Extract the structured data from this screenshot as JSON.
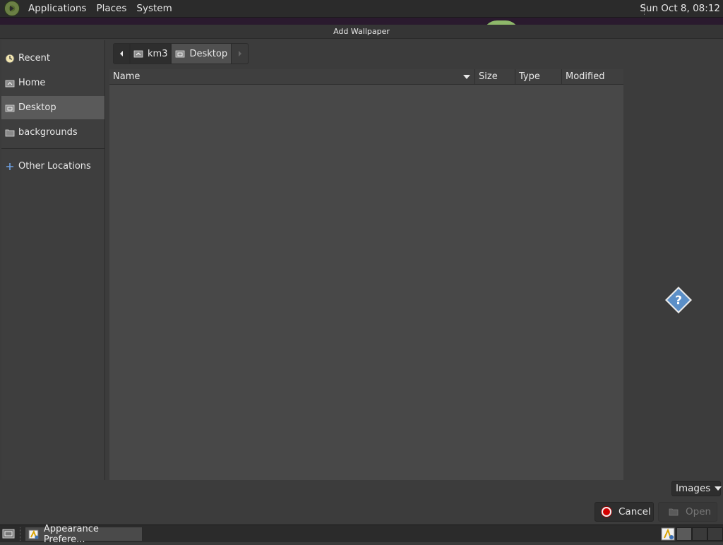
{
  "top_panel": {
    "menus": [
      "Applications",
      "Places",
      "System"
    ],
    "clock": "Sun Oct  8, 08:12"
  },
  "dialog": {
    "title": "Add Wallpaper",
    "sidebar": {
      "items": [
        {
          "label": "Recent",
          "icon": "clock-icon"
        },
        {
          "label": "Home",
          "icon": "home-folder-icon"
        },
        {
          "label": "Desktop",
          "icon": "desktop-folder-icon",
          "selected": true
        },
        {
          "label": "backgrounds",
          "icon": "folder-icon"
        }
      ],
      "other_locations": {
        "label": "Other Locations",
        "icon": "plus-icon"
      }
    },
    "path_bar": {
      "home_label": "km3",
      "current_label": "Desktop"
    },
    "columns": {
      "name": "Name",
      "size": "Size",
      "type": "Type",
      "modified": "Modified"
    },
    "filter": {
      "selected": "Images"
    },
    "buttons": {
      "cancel": "Cancel",
      "open": "Open"
    }
  },
  "taskbar": {
    "window_title": "Appearance Prefere..."
  },
  "colors": {
    "panel_bg": "#2b2b2b",
    "dialog_bg": "#3c3c3c",
    "file_area_bg": "#484848",
    "selected_bg": "#5a5a5a",
    "cancel_red": "#d40000",
    "help_blue": "#5b8fc7"
  }
}
